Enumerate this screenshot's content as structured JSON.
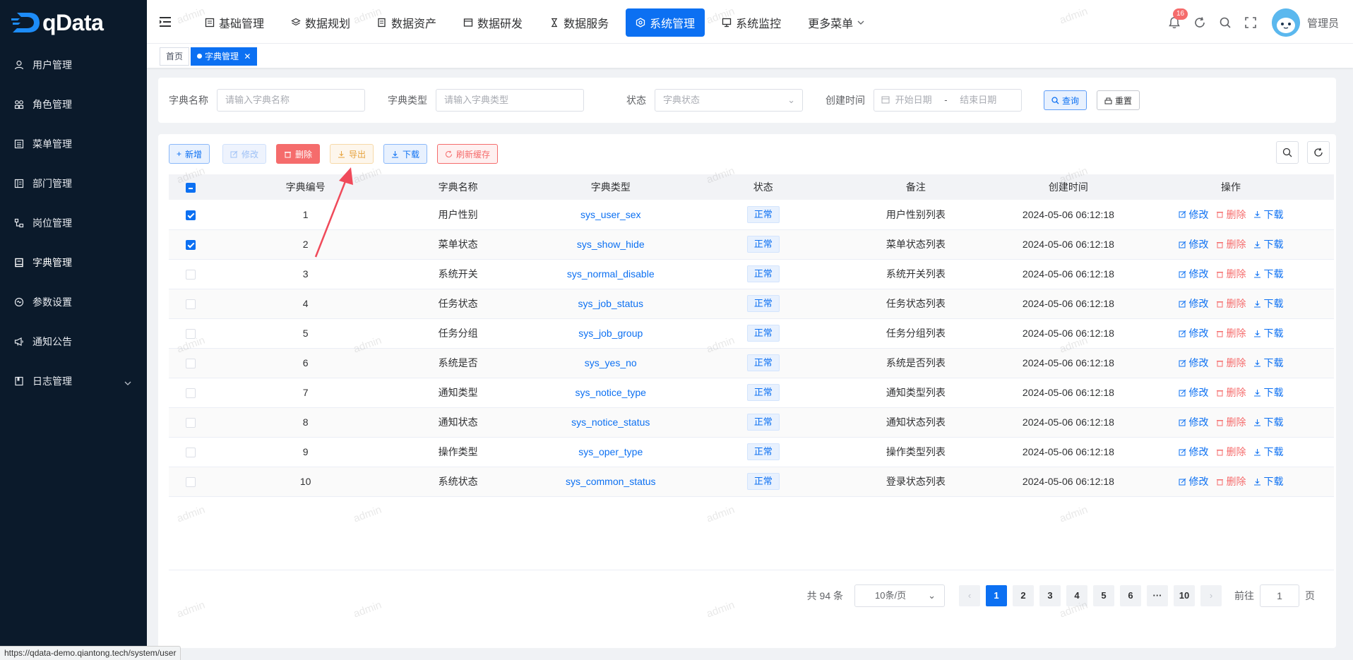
{
  "app": {
    "logo_text": "qData"
  },
  "sidebar": {
    "items": [
      {
        "label": "用户管理",
        "icon": "user-icon"
      },
      {
        "label": "角色管理",
        "icon": "role-icon"
      },
      {
        "label": "菜单管理",
        "icon": "menu-icon"
      },
      {
        "label": "部门管理",
        "icon": "dept-icon"
      },
      {
        "label": "岗位管理",
        "icon": "post-icon"
      },
      {
        "label": "字典管理",
        "icon": "dict-icon",
        "active": true
      },
      {
        "label": "参数设置",
        "icon": "settings-icon"
      },
      {
        "label": "通知公告",
        "icon": "megaphone-icon"
      },
      {
        "label": "日志管理",
        "icon": "log-icon",
        "has_children": true
      }
    ]
  },
  "topnav": {
    "items": [
      {
        "label": "基础管理"
      },
      {
        "label": "数据规划"
      },
      {
        "label": "数据资产"
      },
      {
        "label": "数据研发"
      },
      {
        "label": "数据服务"
      },
      {
        "label": "系统管理",
        "active": true
      },
      {
        "label": "系统监控"
      },
      {
        "label": "更多菜单"
      }
    ],
    "notification_count": "16",
    "user_name": "管理员"
  },
  "tabs": [
    {
      "label": "首页"
    },
    {
      "label": "字典管理",
      "active": true
    }
  ],
  "search": {
    "dict_name_label": "字典名称",
    "dict_name_placeholder": "请输入字典名称",
    "dict_type_label": "字典类型",
    "dict_type_placeholder": "请输入字典类型",
    "status_label": "状态",
    "status_placeholder": "字典状态",
    "created_label": "创建时间",
    "start_placeholder": "开始日期",
    "range_sep": "-",
    "end_placeholder": "结束日期",
    "query_label": "查询",
    "reset_label": "重置"
  },
  "toolbar": {
    "add": "新增",
    "edit": "修改",
    "delete": "删除",
    "export": "导出",
    "download": "下载",
    "refresh_cache": "刷新缓存"
  },
  "table": {
    "columns": [
      "字典编号",
      "字典名称",
      "字典类型",
      "状态",
      "备注",
      "创建时间",
      "操作"
    ],
    "actions": {
      "edit": "修改",
      "delete": "删除",
      "download": "下载"
    },
    "rows": [
      {
        "id": "1",
        "name": "用户性别",
        "type": "sys_user_sex",
        "status": "正常",
        "remark": "用户性别列表",
        "created": "2024-05-06 06:12:18",
        "checked": true
      },
      {
        "id": "2",
        "name": "菜单状态",
        "type": "sys_show_hide",
        "status": "正常",
        "remark": "菜单状态列表",
        "created": "2024-05-06 06:12:18",
        "checked": true
      },
      {
        "id": "3",
        "name": "系统开关",
        "type": "sys_normal_disable",
        "status": "正常",
        "remark": "系统开关列表",
        "created": "2024-05-06 06:12:18",
        "checked": false
      },
      {
        "id": "4",
        "name": "任务状态",
        "type": "sys_job_status",
        "status": "正常",
        "remark": "任务状态列表",
        "created": "2024-05-06 06:12:18",
        "checked": false
      },
      {
        "id": "5",
        "name": "任务分组",
        "type": "sys_job_group",
        "status": "正常",
        "remark": "任务分组列表",
        "created": "2024-05-06 06:12:18",
        "checked": false
      },
      {
        "id": "6",
        "name": "系统是否",
        "type": "sys_yes_no",
        "status": "正常",
        "remark": "系统是否列表",
        "created": "2024-05-06 06:12:18",
        "checked": false
      },
      {
        "id": "7",
        "name": "通知类型",
        "type": "sys_notice_type",
        "status": "正常",
        "remark": "通知类型列表",
        "created": "2024-05-06 06:12:18",
        "checked": false
      },
      {
        "id": "8",
        "name": "通知状态",
        "type": "sys_notice_status",
        "status": "正常",
        "remark": "通知状态列表",
        "created": "2024-05-06 06:12:18",
        "checked": false
      },
      {
        "id": "9",
        "name": "操作类型",
        "type": "sys_oper_type",
        "status": "正常",
        "remark": "操作类型列表",
        "created": "2024-05-06 06:12:18",
        "checked": false
      },
      {
        "id": "10",
        "name": "系统状态",
        "type": "sys_common_status",
        "status": "正常",
        "remark": "登录状态列表",
        "created": "2024-05-06 06:12:18",
        "checked": false
      }
    ]
  },
  "pagination": {
    "total_text": "共 94 条",
    "page_size": "10条/页",
    "pages": [
      "1",
      "2",
      "3",
      "4",
      "5",
      "6",
      "···",
      "10"
    ],
    "current": "1",
    "goto_prefix": "前往",
    "goto_value": "1",
    "goto_suffix": "页"
  },
  "watermark_text": "admin",
  "statusbar_url": "https://qdata-demo.qiantong.tech/system/user",
  "colors": {
    "primary": "#0c70f2",
    "danger": "#f56c6c",
    "warning": "#e6a23c",
    "sidebar_bg": "#0b1a2b"
  }
}
